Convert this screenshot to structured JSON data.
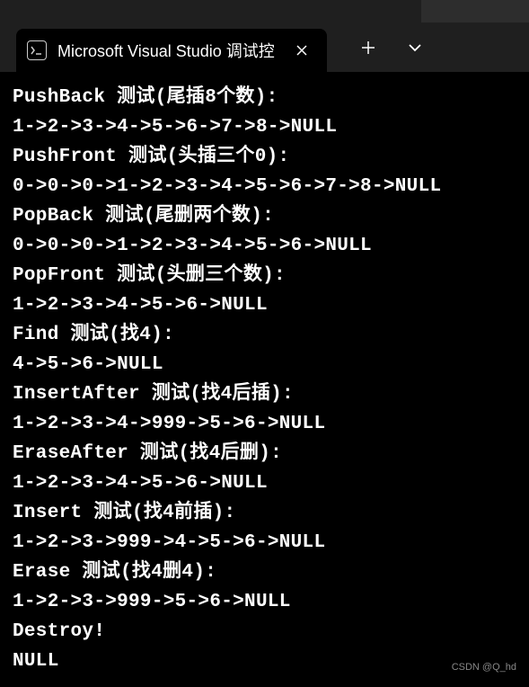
{
  "tab": {
    "icon_label": "C:\\",
    "title": "Microsoft Visual Studio 调试控"
  },
  "console_lines": [
    "PushBack 测试(尾插8个数):",
    "1->2->3->4->5->6->7->8->NULL",
    "PushFront 测试(头插三个0):",
    "0->0->0->1->2->3->4->5->6->7->8->NULL",
    "PopBack 测试(尾删两个数):",
    "0->0->0->1->2->3->4->5->6->NULL",
    "PopFront 测试(头删三个数):",
    "1->2->3->4->5->6->NULL",
    "Find 测试(找4):",
    "4->5->6->NULL",
    "InsertAfter 测试(找4后插):",
    "1->2->3->4->999->5->6->NULL",
    "EraseAfter 测试(找4后删):",
    "1->2->3->4->5->6->NULL",
    "Insert 测试(找4前插):",
    "1->2->3->999->4->5->6->NULL",
    "Erase 测试(找4删4):",
    "1->2->3->999->5->6->NULL",
    "Destroy!",
    "NULL"
  ],
  "watermark": "CSDN @Q_hd"
}
